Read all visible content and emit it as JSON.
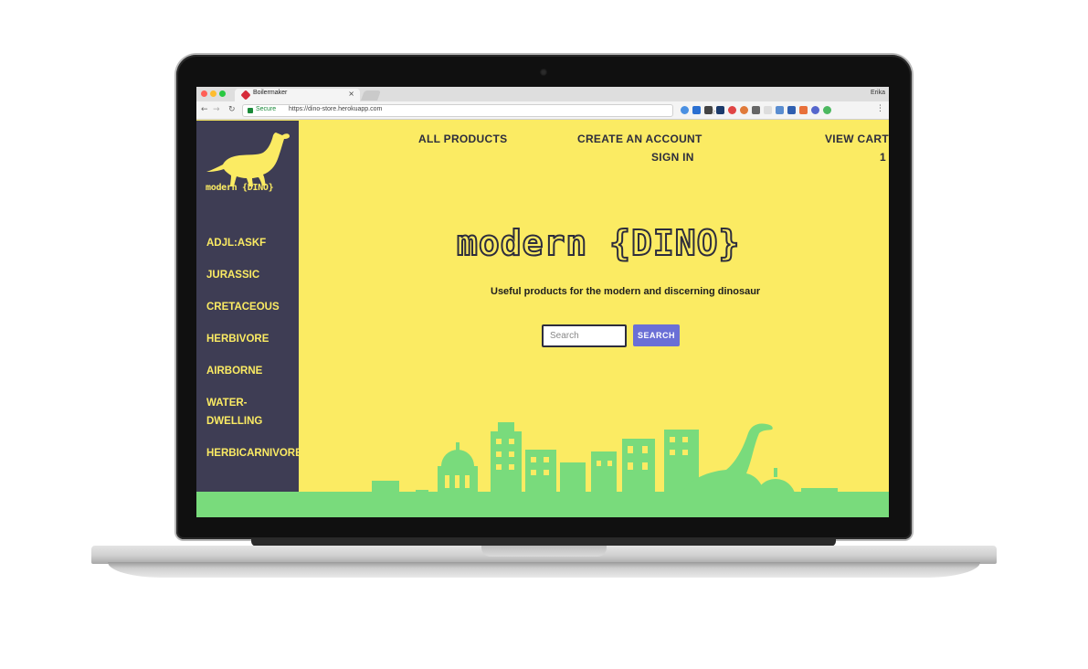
{
  "browser": {
    "tab_title": "Boilermaker",
    "tab_close": "×",
    "profile_name": "Erika",
    "secure_label": "Secure",
    "url": "https://dino-store.herokuapp.com"
  },
  "colors": {
    "page_bg": "#fbeb63",
    "sidebar_bg": "#3e3d54",
    "accent_yellow": "#fbeb63",
    "ground_green": "#79db7c",
    "search_button": "#6a6fd6",
    "nav_text": "#2d2d3d"
  },
  "sidebar": {
    "logo_text": "modern {DINO}",
    "categories": [
      {
        "label": "ADJL:ASKF"
      },
      {
        "label": "JURASSIC"
      },
      {
        "label": "CRETACEOUS"
      },
      {
        "label": "HERBIVORE"
      },
      {
        "label": "AIRBORNE"
      },
      {
        "label": "WATER-DWELLING"
      },
      {
        "label": "HERBICARNIVORE"
      }
    ]
  },
  "nav": {
    "all_products": "ALL PRODUCTS",
    "create_account": "CREATE AN ACCOUNT",
    "sign_in": "SIGN IN",
    "view_cart": "VIEW CART",
    "cart_count": "1"
  },
  "hero": {
    "title": "modern {DINO}",
    "tagline": "Useful products for the modern and discerning dinosaur"
  },
  "search": {
    "placeholder": "Search",
    "button_label": "SEARCH"
  },
  "icons": [
    "back-icon",
    "forward-icon",
    "reload-icon",
    "lock-icon",
    "star-icon",
    "menu-icon",
    "dino-logo-icon",
    "city-skyline-icon"
  ]
}
